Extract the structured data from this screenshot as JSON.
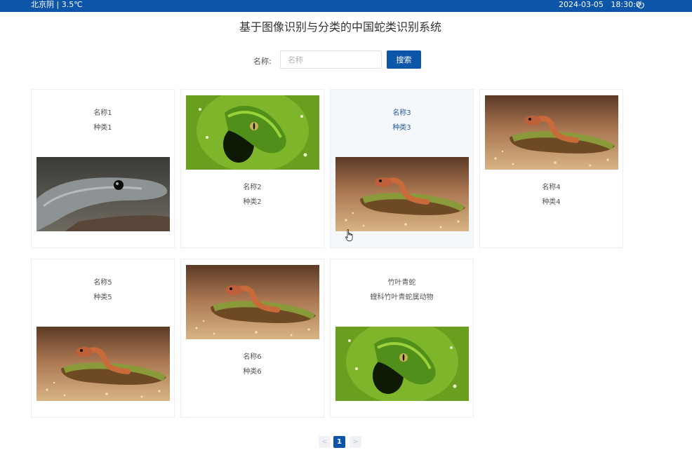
{
  "topbar": {
    "weather": "北京阴 | 3.5℃",
    "datetime": "2024-03-05   18:30:0"
  },
  "title": "基于图像识别与分类的中国蛇类识别系统",
  "search": {
    "label": "名称:",
    "placeholder": "名称",
    "value": "",
    "button": "搜索"
  },
  "cards": [
    {
      "name": "名称1",
      "type": "种类1",
      "image": "black-mamba"
    },
    {
      "name": "名称2",
      "type": "种类2",
      "image": "green-tree-python"
    },
    {
      "name": "名称3",
      "type": "种类3",
      "image": "red-neck-snake"
    },
    {
      "name": "名称4",
      "type": "种类4",
      "image": "red-neck-snake"
    },
    {
      "name": "名称5",
      "type": "种类5",
      "image": "red-neck-snake"
    },
    {
      "name": "名称6",
      "type": "种类6",
      "image": "red-neck-snake"
    },
    {
      "name": "竹叶青蛇",
      "type": "蝰科竹叶青蛇属动物",
      "image": "green-tree-python"
    }
  ],
  "pagination": {
    "prev": "<",
    "current": "1",
    "next": ">"
  }
}
